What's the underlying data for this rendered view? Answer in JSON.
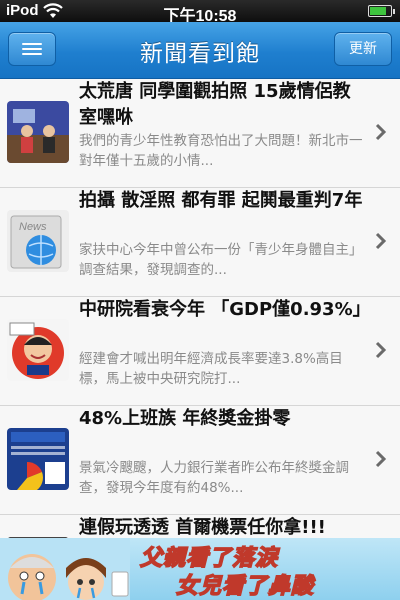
{
  "status": {
    "carrier": "iPod",
    "time": "下午10:58",
    "battery_level": 0.8
  },
  "navbar": {
    "title": "新聞看到飽",
    "refresh_label": "更新"
  },
  "articles": [
    {
      "headline": "太荒唐 同學圍觀拍照 15歲情侶教室嘿咻",
      "summary": "我們的青少年性教育恐怕出了大問題！新北市一對年僅十五歲的小情...",
      "thumb_icon": "classroom-photo-thumbnail"
    },
    {
      "headline": "拍攝 散淫照 都有罪 起鬨最重判7年",
      "summary": "家扶中心今年中曾公布一份「青少年身體自主」調查結果，發現調查的...",
      "thumb_icon": "news-globe-icon"
    },
    {
      "headline": "中研院看衰今年 「GDP僅0.93%」",
      "summary": "經建會才喊出明年經濟成長率要達3.8%高目標，馬上被中央研究院打...",
      "thumb_icon": "politician-caricature-thumbnail"
    },
    {
      "headline": "48%上班族 年終獎金掛零",
      "summary": "景氣冷颼颼，人力銀行業者昨公布年終獎金調查，發現今年度有約48%...",
      "thumb_icon": "survey-chart-thumbnail"
    },
    {
      "headline": "連假玩透透 首爾機票任你拿!!!",
      "summary": "",
      "thumb_icon": "travel-thumbnail"
    }
  ],
  "ad": {
    "line1": "父親看了落淚",
    "line2": "女兒看了鼻酸"
  },
  "colors": {
    "nav_blue": "#2384d2",
    "headline": "#111111",
    "summary": "#8a8a8a"
  }
}
